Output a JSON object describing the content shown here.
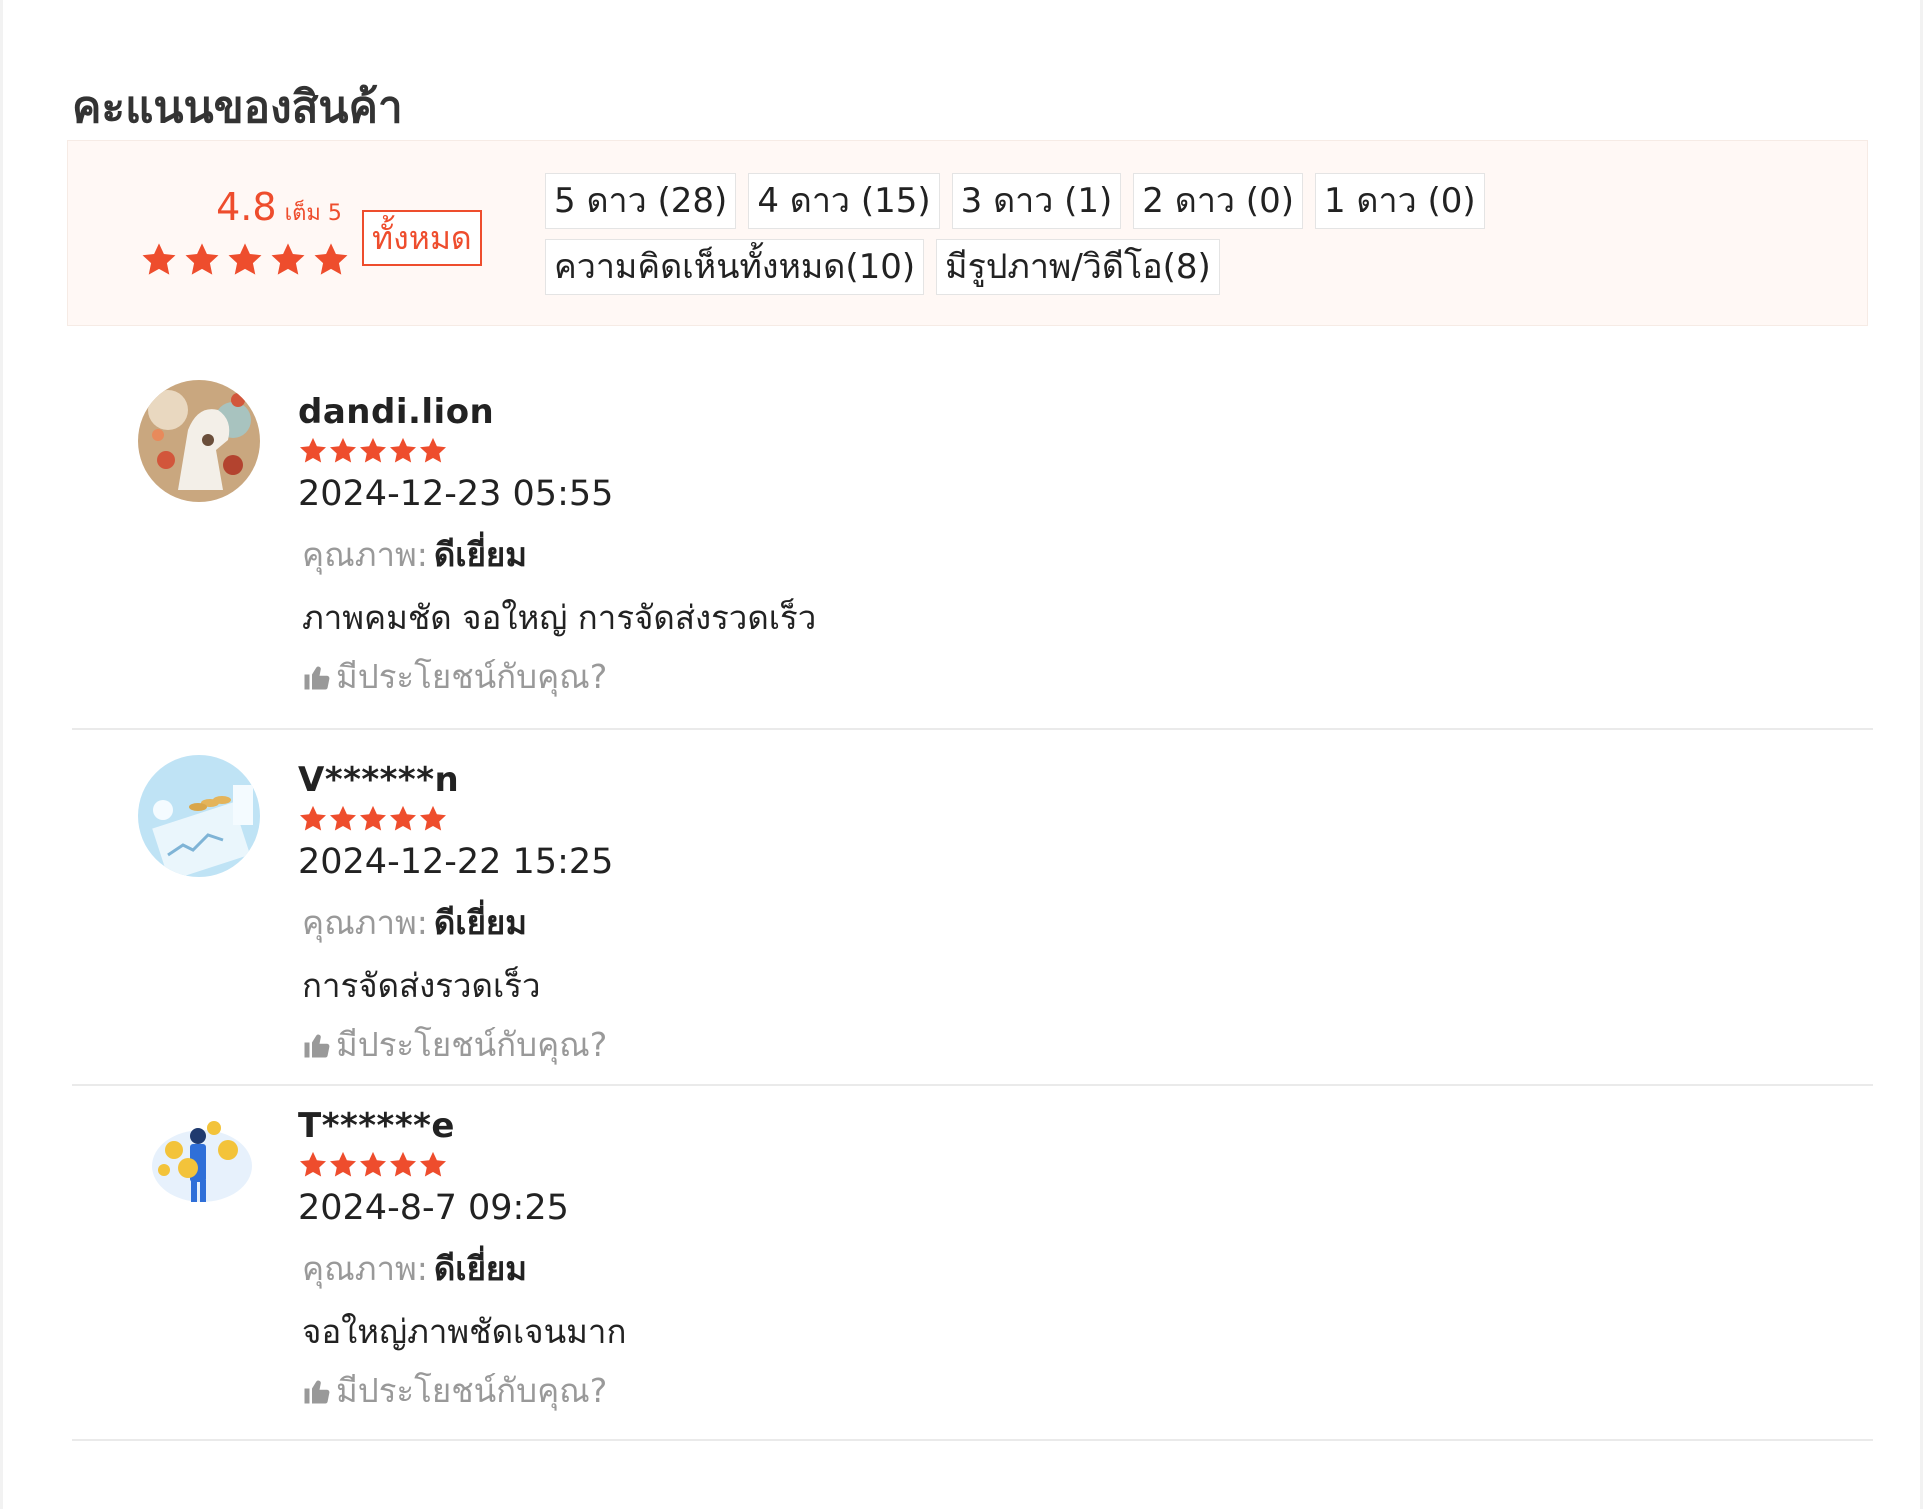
{
  "section": {
    "title": "คะแนนของสินค้า"
  },
  "summary": {
    "score": "4.8",
    "out_of": "เต็ม 5",
    "stars": 5,
    "all_button": "ทั้งหมด",
    "filters": [
      "5 ดาว (28)",
      "4 ดาว (15)",
      "3 ดาว (1)",
      "2 ดาว (0)",
      "1 ดาว (0)",
      "ความคิดเห็นทั้งหมด(10)",
      "มีรูปภาพ/วิดีโอ(8)"
    ]
  },
  "reviews": [
    {
      "username": "dandi.lion",
      "stars": 5,
      "date": "2024-12-23 05:55",
      "quality_label": "คุณภาพ:",
      "quality_value": "ดีเยี่ยม",
      "comment": "ภาพคมชัด จอใหญ่ การจัดส่งรวดเร็ว",
      "helpful": "มีประโยชน์กับคุณ?",
      "avatar_icon": "horse-avatar"
    },
    {
      "username": "V******n",
      "stars": 5,
      "date": "2024-12-22 15:25",
      "quality_label": "คุณภาพ:",
      "quality_value": "ดีเยี่ยม",
      "comment": "การจัดส่งรวดเร็ว",
      "helpful": "มีประโยชน์กับคุณ?",
      "avatar_icon": "finance-avatar"
    },
    {
      "username": "T******e",
      "stars": 5,
      "date": "2024-8-7 09:25",
      "quality_label": "คุณภาพ:",
      "quality_value": "ดีเยี่ยม",
      "comment": "จอใหญ่ภาพชัดเจนมาก",
      "helpful": "มีประโยชน์กับคุณ?",
      "avatar_icon": "coins-person-avatar"
    }
  ],
  "colors": {
    "accent": "#ee4d2d",
    "summary_bg": "#fff8f5",
    "muted": "#999999"
  }
}
